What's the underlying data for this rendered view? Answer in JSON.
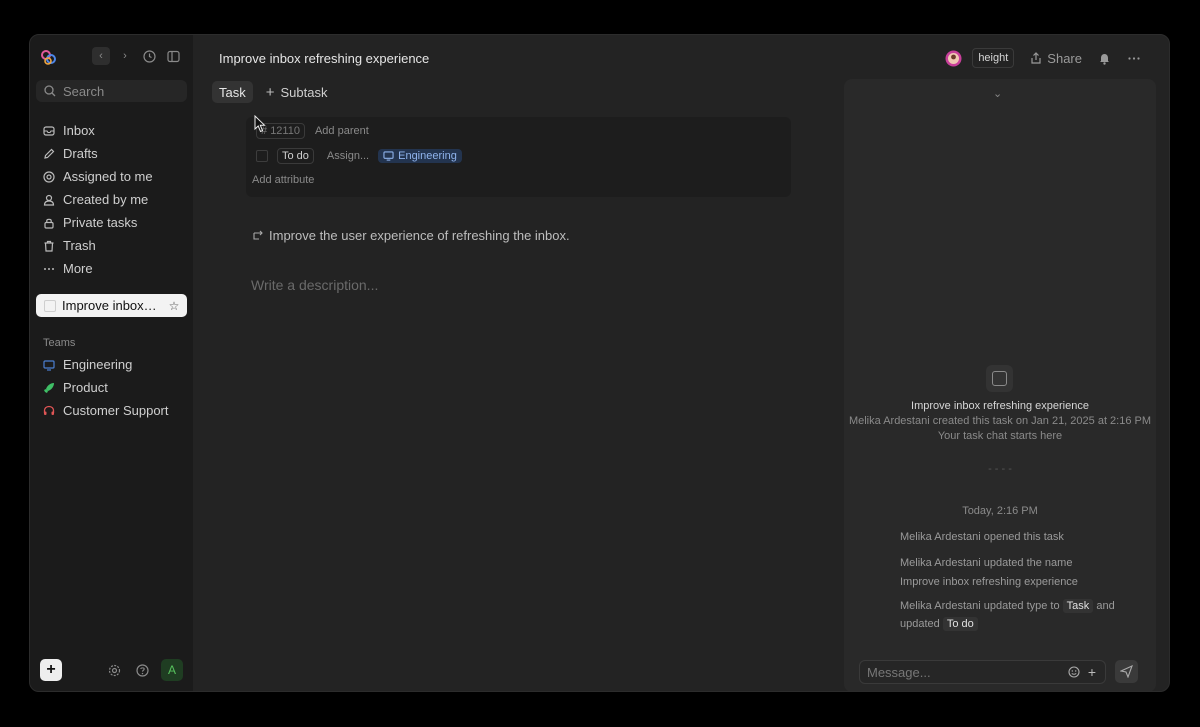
{
  "sidebar": {
    "search_placeholder": "Search",
    "nav": [
      {
        "label": "Inbox",
        "icon": "inbox-icon"
      },
      {
        "label": "Drafts",
        "icon": "pencil-icon"
      },
      {
        "label": "Assigned to me",
        "icon": "target-icon"
      },
      {
        "label": "Created by me",
        "icon": "user-icon"
      },
      {
        "label": "Private tasks",
        "icon": "lock-icon"
      },
      {
        "label": "Trash",
        "icon": "trash-icon"
      },
      {
        "label": "More",
        "icon": "more-icon"
      }
    ],
    "current_task": "Improve inbox refreshing experience",
    "teams_label": "Teams",
    "teams": [
      {
        "label": "Engineering",
        "icon": "monitor-icon",
        "color": "#4b7fd1"
      },
      {
        "label": "Product",
        "icon": "rocket-icon",
        "color": "#3fbf66"
      },
      {
        "label": "Customer Support",
        "icon": "headset-icon",
        "color": "#e05555"
      }
    ],
    "avatar_letter": "A"
  },
  "header": {
    "title": "Improve inbox refreshing experience",
    "workspace": "height",
    "share_label": "Share"
  },
  "tabs": {
    "task": "Task",
    "subtask": "Subtask"
  },
  "attributes": {
    "task_id": "12110",
    "add_parent": "Add parent",
    "status": "To do",
    "assignee_placeholder": "Assign...",
    "team": "Engineering",
    "add_attribute": "Add attribute"
  },
  "summary": "Improve the user experience of refreshing the inbox.",
  "description_placeholder": "Write a description...",
  "chat": {
    "task_title": "Improve inbox refreshing experience",
    "created_line": "Melika Ardestani created this task on Jan 21, 2025 at 2:16 PM",
    "starts_here": "Your task chat starts here",
    "divider": "- - - -",
    "date": "Today, 2:16 PM",
    "log_opened": "Melika Ardestani opened this task",
    "log_name": "Melika Ardestani updated the name",
    "log_name_value": "Improve inbox refreshing experience",
    "log_type_prefix": "Melika Ardestani updated type to",
    "log_type_value": "Task",
    "log_and": "and",
    "log_updated": "updated",
    "log_status_value": "To do",
    "message_placeholder": "Message..."
  },
  "colors": {
    "background": "#232323",
    "sidebar": "#1b1b1b",
    "chat_panel": "#292929",
    "team_chip": "#23344f"
  }
}
